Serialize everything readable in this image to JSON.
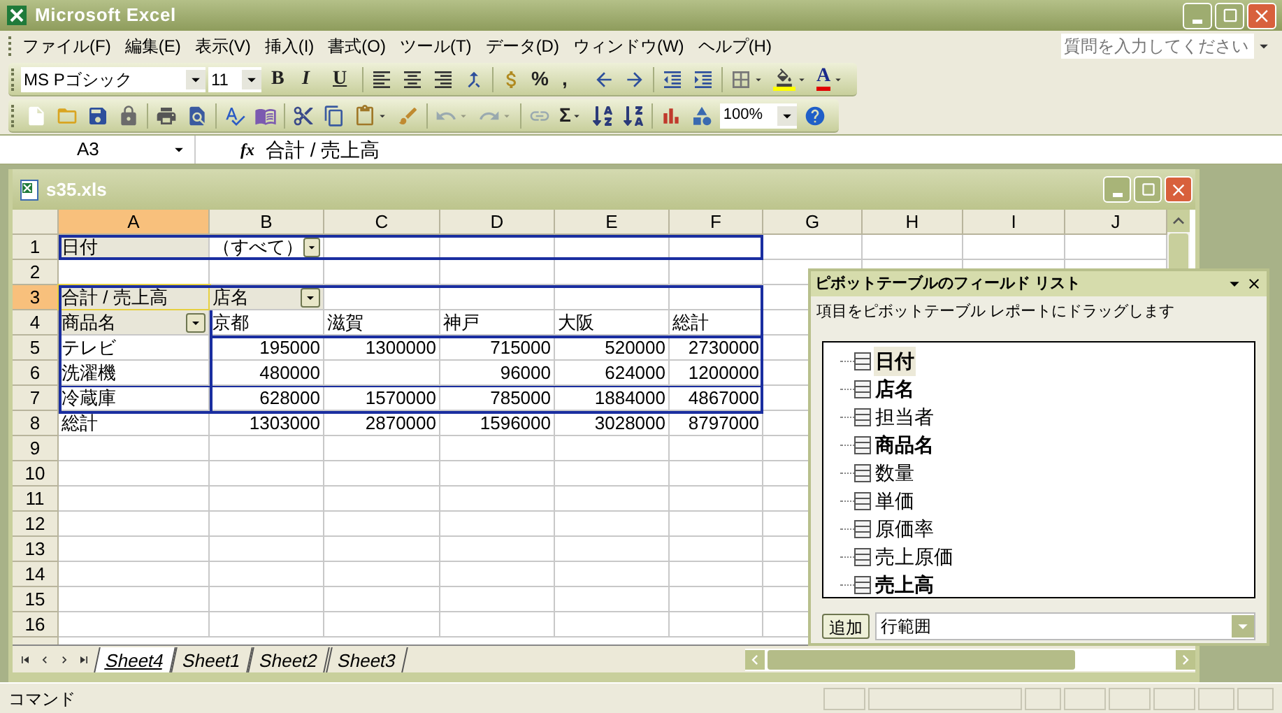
{
  "window": {
    "title": "Microsoft Excel"
  },
  "menu": [
    {
      "label": "ファイル(F)"
    },
    {
      "label": "編集(E)"
    },
    {
      "label": "表示(V)"
    },
    {
      "label": "挿入(I)"
    },
    {
      "label": "書式(O)"
    },
    {
      "label": "ツール(T)"
    },
    {
      "label": "データ(D)"
    },
    {
      "label": "ウィンドウ(W)"
    },
    {
      "label": "ヘルプ(H)"
    }
  ],
  "help_box": {
    "placeholder": "質問を入力してください"
  },
  "formatting_toolbar": {
    "font": "MS Pゴシック",
    "size": "11",
    "buttons": [
      {
        "kind": "bold",
        "text": "B",
        "dropdown": false,
        "disabled": false
      },
      {
        "kind": "italic",
        "text": "I",
        "dropdown": false,
        "disabled": false
      },
      {
        "kind": "underline",
        "text": "U",
        "dropdown": false,
        "disabled": false
      },
      {
        "kind": "separator"
      },
      {
        "kind": "align-left",
        "dropdown": false,
        "disabled": false
      },
      {
        "kind": "align-center",
        "dropdown": false,
        "disabled": false
      },
      {
        "kind": "align-right",
        "dropdown": false,
        "disabled": false
      },
      {
        "kind": "merge",
        "dropdown": false,
        "disabled": false
      },
      {
        "kind": "separator"
      },
      {
        "kind": "currency",
        "dropdown": false,
        "disabled": false
      },
      {
        "kind": "glyph",
        "text": "%",
        "dropdown": false,
        "disabled": false
      },
      {
        "kind": "glyph",
        "text": ",",
        "dropdown": false,
        "disabled": false
      },
      {
        "kind": "decimal-increase",
        "dropdown": false,
        "disabled": false
      },
      {
        "kind": "decimal-decrease",
        "dropdown": false,
        "disabled": false
      },
      {
        "kind": "separator"
      },
      {
        "kind": "indent-decrease",
        "dropdown": false,
        "disabled": false
      },
      {
        "kind": "indent-increase",
        "dropdown": false,
        "disabled": false
      },
      {
        "kind": "separator"
      },
      {
        "kind": "borders",
        "dropdown": true,
        "disabled": false
      },
      {
        "kind": "fill-color",
        "dropdown": true,
        "disabled": false
      },
      {
        "kind": "font-color",
        "text": "A",
        "dropdown": true,
        "disabled": false
      }
    ]
  },
  "standard_toolbar": {
    "buttons": [
      {
        "kind": "new",
        "dropdown": false,
        "disabled": false
      },
      {
        "kind": "open",
        "dropdown": false,
        "disabled": false
      },
      {
        "kind": "save",
        "dropdown": false,
        "disabled": false
      },
      {
        "kind": "permission",
        "dropdown": false,
        "disabled": false
      },
      {
        "kind": "separator"
      },
      {
        "kind": "print",
        "dropdown": false,
        "disabled": false
      },
      {
        "kind": "preview",
        "dropdown": false,
        "disabled": false
      },
      {
        "kind": "separator"
      },
      {
        "kind": "spelling",
        "dropdown": false,
        "disabled": false
      },
      {
        "kind": "research",
        "dropdown": false,
        "disabled": false
      },
      {
        "kind": "separator"
      },
      {
        "kind": "cut",
        "dropdown": false,
        "disabled": false
      },
      {
        "kind": "copy",
        "dropdown": false,
        "disabled": false
      },
      {
        "kind": "paste",
        "dropdown": true,
        "disabled": false
      },
      {
        "kind": "format-painter",
        "dropdown": false,
        "disabled": false
      },
      {
        "kind": "separator"
      },
      {
        "kind": "undo",
        "dropdown": true,
        "disabled": true
      },
      {
        "kind": "redo",
        "dropdown": true,
        "disabled": true
      },
      {
        "kind": "separator"
      },
      {
        "kind": "hyperlink",
        "dropdown": false,
        "disabled": true
      },
      {
        "kind": "glyph",
        "text": "Σ",
        "dropdown": true,
        "disabled": false
      },
      {
        "kind": "sort-ascending",
        "dropdown": false,
        "disabled": false
      },
      {
        "kind": "sort-descending",
        "dropdown": false,
        "disabled": false
      },
      {
        "kind": "separator"
      },
      {
        "kind": "chart",
        "dropdown": false,
        "disabled": false
      },
      {
        "kind": "drawing",
        "dropdown": false,
        "disabled": false
      },
      {
        "kind": "zoom",
        "text": "100%"
      },
      {
        "kind": "help",
        "dropdown": false,
        "disabled": false
      }
    ]
  },
  "formula_bar": {
    "name_box": "A3",
    "fx": "fx",
    "formula": "合計 / 売上高"
  },
  "workbook": {
    "title": "s35.xls",
    "columns": [
      {
        "label": "A",
        "selected": true
      },
      {
        "label": "B",
        "selected": false
      },
      {
        "label": "C",
        "selected": false
      },
      {
        "label": "D",
        "selected": false
      },
      {
        "label": "E",
        "selected": false
      },
      {
        "label": "F",
        "selected": false
      },
      {
        "label": "G",
        "selected": false
      },
      {
        "label": "H",
        "selected": false
      },
      {
        "label": "I",
        "selected": false
      },
      {
        "label": "J",
        "selected": false
      }
    ],
    "rows": [
      {
        "label": "1",
        "selected": false,
        "cells": [
          {
            "kind": "field",
            "text": "日付"
          },
          {
            "kind": "page-value",
            "text": "（すべて）"
          }
        ]
      },
      {
        "label": "2",
        "selected": false
      },
      {
        "label": "3",
        "selected": true,
        "cells": [
          {
            "kind": "field",
            "text": "合計 / 売上高"
          },
          {
            "kind": "field-dropdown",
            "text": "店名"
          }
        ]
      },
      {
        "label": "4",
        "selected": false,
        "cells": [
          {
            "kind": "field-dropdown",
            "text": "商品名"
          },
          {
            "kind": "label",
            "text": "京都"
          },
          {
            "kind": "label",
            "text": "滋賀"
          },
          {
            "kind": "label",
            "text": "神戸"
          },
          {
            "kind": "label",
            "text": "大阪"
          },
          {
            "kind": "label",
            "text": "総計"
          }
        ]
      },
      {
        "label": "5",
        "selected": false,
        "cells": [
          {
            "kind": "label",
            "text": "テレビ"
          },
          {
            "kind": "number",
            "text": "195000"
          },
          {
            "kind": "number",
            "text": "1300000"
          },
          {
            "kind": "number",
            "text": "715000"
          },
          {
            "kind": "number",
            "text": "520000"
          },
          {
            "kind": "number",
            "text": "2730000"
          }
        ]
      },
      {
        "label": "6",
        "selected": false,
        "cells": [
          {
            "kind": "label",
            "text": "洗濯機"
          },
          {
            "kind": "number",
            "text": "480000"
          },
          {
            "kind": "empty"
          },
          {
            "kind": "number",
            "text": "96000"
          },
          {
            "kind": "number",
            "text": "624000"
          },
          {
            "kind": "number",
            "text": "1200000"
          }
        ]
      },
      {
        "label": "7",
        "selected": false,
        "cells": [
          {
            "kind": "label",
            "text": "冷蔵庫"
          },
          {
            "kind": "number",
            "text": "628000"
          },
          {
            "kind": "number",
            "text": "1570000"
          },
          {
            "kind": "number",
            "text": "785000"
          },
          {
            "kind": "number",
            "text": "1884000"
          },
          {
            "kind": "number",
            "text": "4867000"
          }
        ]
      },
      {
        "label": "8",
        "selected": false,
        "cells": [
          {
            "kind": "label",
            "text": "総計"
          },
          {
            "kind": "number",
            "text": "1303000"
          },
          {
            "kind": "number",
            "text": "2870000"
          },
          {
            "kind": "number",
            "text": "1596000"
          },
          {
            "kind": "number",
            "text": "3028000"
          },
          {
            "kind": "number",
            "text": "8797000"
          }
        ]
      },
      {
        "label": "9",
        "selected": false
      },
      {
        "label": "10",
        "selected": false
      },
      {
        "label": "11",
        "selected": false
      },
      {
        "label": "12",
        "selected": false
      },
      {
        "label": "13",
        "selected": false
      },
      {
        "label": "14",
        "selected": false
      },
      {
        "label": "15",
        "selected": false
      },
      {
        "label": "16",
        "selected": false
      }
    ],
    "sheet_tabs": [
      {
        "label": "Sheet4",
        "selected": true
      },
      {
        "label": "Sheet1",
        "selected": false
      },
      {
        "label": "Sheet2",
        "selected": false
      },
      {
        "label": "Sheet3",
        "selected": false
      }
    ]
  },
  "field_list": {
    "title": "ピボットテーブルのフィールド リスト",
    "hint": "項目をピボットテーブル レポートにドラッグします",
    "fields": [
      {
        "name": "日付",
        "bold": true,
        "selected": true
      },
      {
        "name": "店名",
        "bold": true,
        "selected": false
      },
      {
        "name": "担当者",
        "bold": false,
        "selected": false
      },
      {
        "name": "商品名",
        "bold": true,
        "selected": false
      },
      {
        "name": "数量",
        "bold": false,
        "selected": false
      },
      {
        "name": "単価",
        "bold": false,
        "selected": false
      },
      {
        "name": "原価率",
        "bold": false,
        "selected": false
      },
      {
        "name": "売上原価",
        "bold": false,
        "selected": false
      },
      {
        "name": "売上高",
        "bold": true,
        "selected": false
      }
    ],
    "add_button": "追加",
    "area": "行範囲"
  },
  "status_bar": {
    "text": "コマンド"
  }
}
